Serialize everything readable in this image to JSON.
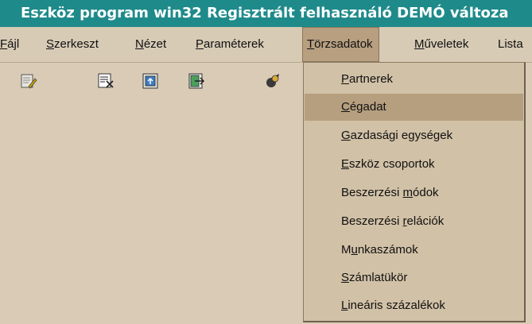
{
  "window": {
    "title": "Eszköz program win32 Regisztrált felhasználó  DEMÓ változa"
  },
  "menubar": {
    "items": [
      {
        "pre": "",
        "u": "F",
        "post": "ájl"
      },
      {
        "pre": "",
        "u": "S",
        "post": "zerkeszt"
      },
      {
        "pre": "",
        "u": "N",
        "post": "ézet"
      },
      {
        "pre": "",
        "u": "P",
        "post": "araméterek"
      },
      {
        "pre": "",
        "u": "T",
        "post": "örzsadatok"
      },
      {
        "pre": "",
        "u": "M",
        "post": "űveletek"
      },
      {
        "pre": "",
        "u": "",
        "post": "Lista"
      }
    ],
    "active_index": 4
  },
  "toolbar": {
    "icons": [
      "edit-icon",
      "cut-icon",
      "refresh-icon",
      "exit-icon",
      "cursor-icon"
    ]
  },
  "dropdown": {
    "items": [
      {
        "pre": "",
        "u": "P",
        "post": "artnerek"
      },
      {
        "pre": "",
        "u": "C",
        "post": "égadat"
      },
      {
        "pre": "",
        "u": "G",
        "post": "azdasági egységek"
      },
      {
        "pre": "",
        "u": "E",
        "post": "szköz csoportok"
      },
      {
        "pre": "Beszerzési ",
        "u": "m",
        "post": "ódok"
      },
      {
        "pre": "Beszerzési ",
        "u": "r",
        "post": "elációk"
      },
      {
        "pre": "M",
        "u": "u",
        "post": "nkaszámok"
      },
      {
        "pre": "",
        "u": "S",
        "post": "zámlatükör"
      },
      {
        "pre": "",
        "u": "L",
        "post": "ineáris százalékok"
      }
    ],
    "highlighted_index": 1
  },
  "colors": {
    "titlebar": "#1f8a8a",
    "menubar": "#d8cbb5",
    "active_menu": "#b79f80",
    "dropdown": "#d1c1a6",
    "highlight": "#b59f7f"
  }
}
